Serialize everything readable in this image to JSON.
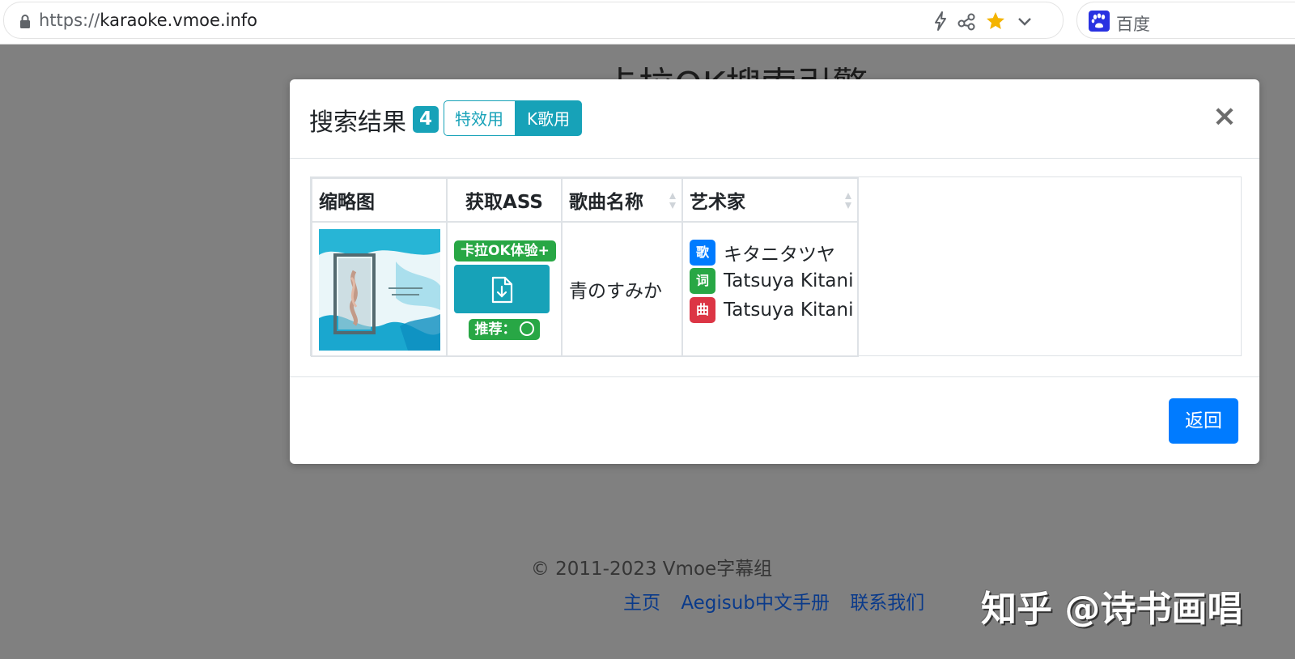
{
  "browser": {
    "url_scheme": "https://",
    "url_host": "karaoke.vmoe.info",
    "search_engine_label": "百度",
    "icons": [
      "lock-icon",
      "lightning-icon",
      "share-icon",
      "star-icon",
      "chevron-down-icon",
      "baidu-paw-icon"
    ],
    "star_color": "#f4b400"
  },
  "page": {
    "title_behind": "卡拉OK搜索引擎",
    "footer_copyright": "© 2011-2023 Vmoe字幕组",
    "footer_links": [
      "主页",
      "Aegisub中文手册",
      "联系我们"
    ],
    "watermark": "知乎 @诗书画唱"
  },
  "modal": {
    "title": "搜索结果",
    "count": "4",
    "toggle": {
      "effects_label": "特效用",
      "karaoke_label": "K歌用",
      "active": "K歌用"
    },
    "close_symbol": "×",
    "table": {
      "headers": [
        "缩略图",
        "获取ASS",
        "歌曲名称",
        "艺术家"
      ],
      "rows": [
        {
          "thumbnail_icon": "album-cover-thumbnail",
          "ass_badge": "卡拉OK体验+",
          "download_icon": "file-download-icon",
          "recommend_label": "推荐：",
          "song_name": "青のすみか",
          "artists": [
            {
              "role": "歌",
              "name": "キタニタツヤ"
            },
            {
              "role": "词",
              "name": "Tatsuya Kitani"
            },
            {
              "role": "曲",
              "name": "Tatsuya Kitani"
            }
          ]
        }
      ]
    },
    "back_label": "返回"
  },
  "colors": {
    "info": "#17a2b8",
    "primary": "#007bff",
    "success": "#28a745",
    "danger": "#dc3545",
    "overlay": "#808080"
  }
}
